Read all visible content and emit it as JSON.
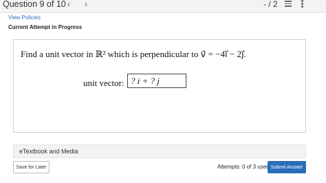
{
  "header": {
    "question_counter": "Question 9 of 10",
    "prev_glyph": "‹",
    "next_glyph": "›",
    "score": "- / 2",
    "icons": [
      "list-icon",
      "more-vertical-icon"
    ]
  },
  "policies_link": "View Policies",
  "attempt_status": "Current Attempt in Progress",
  "question": {
    "prompt": "Find a unit vector in ℝ² which is perpendicular to v⃗ = −4i⃗ − 2j⃗.",
    "answer_label": "unit vector:",
    "answer_value": "? i + ? j"
  },
  "etextbook_label": "eTextbook and Media",
  "footer": {
    "save_label": "Save for Later",
    "attempts_text": "Attempts: 0 of 3 used",
    "submit_label": "Submit Answer"
  },
  "colors": {
    "link": "#2a6ebb",
    "primary_button": "#2a6ebb"
  }
}
